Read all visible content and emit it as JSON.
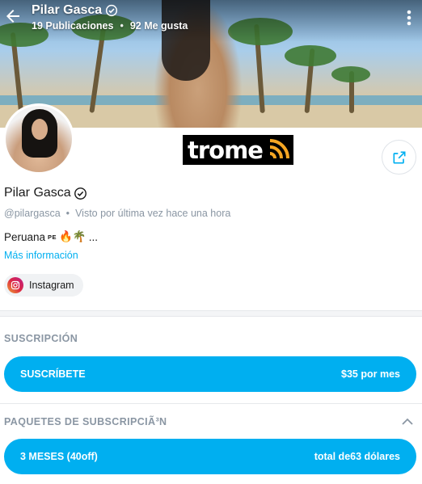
{
  "header": {
    "name": "Pilar Gasca",
    "posts": "19 Publicaciones",
    "separator": "•",
    "likes": "92 Me gusta"
  },
  "logo": {
    "text": "trome",
    "colors": {
      "accent": "#f5a623",
      "background": "#000000"
    }
  },
  "profile": {
    "name": "Pilar Gasca",
    "handle": "@pilargasca",
    "separator": "•",
    "last_seen": "Visto por última vez hace una hora",
    "bio_text": "Peruana",
    "bio_flag": "PE",
    "bio_emojis": "🔥🌴",
    "bio_ellipsis": "...",
    "more_info": "Más información",
    "social": {
      "label": "Instagram",
      "icon": "instagram-icon"
    }
  },
  "subscription": {
    "title": "SUSCRIPCIÓN",
    "button_label": "SUSCRÍBETE",
    "price": "$35 por mes"
  },
  "bundles": {
    "title": "PAQUETES DE SUBSCRIPCIÃ³N",
    "items": [
      {
        "label": "3 MESES (40off)",
        "price": "total de63 dólares"
      }
    ]
  },
  "colors": {
    "accent": "#00aff0",
    "muted": "#8a96a3",
    "verified": "#1a1a1a"
  }
}
